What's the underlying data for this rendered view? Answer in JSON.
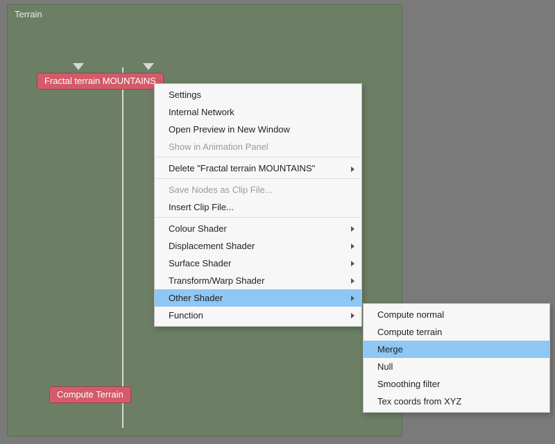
{
  "panel": {
    "title": "Terrain"
  },
  "nodes": {
    "mountains": "Fractal terrain MOUNTAINS",
    "compute": "Compute Terrain"
  },
  "menu": {
    "items": [
      {
        "label": "Settings"
      },
      {
        "label": "Internal Network"
      },
      {
        "label": "Open Preview in New Window"
      },
      {
        "label": "Show in Animation Panel",
        "disabled": true
      },
      {
        "label": "Delete \"Fractal terrain MOUNTAINS\"",
        "submenu": true
      },
      {
        "label": "Save Nodes as Clip File...",
        "disabled": true
      },
      {
        "label": "Insert Clip File..."
      },
      {
        "label": "Colour Shader",
        "submenu": true
      },
      {
        "label": "Displacement Shader",
        "submenu": true
      },
      {
        "label": "Surface Shader",
        "submenu": true
      },
      {
        "label": "Transform/Warp Shader",
        "submenu": true
      },
      {
        "label": "Other Shader",
        "submenu": true,
        "highlight": true
      },
      {
        "label": "Function",
        "submenu": true
      }
    ]
  },
  "submenu": {
    "items": [
      {
        "label": "Compute normal"
      },
      {
        "label": "Compute terrain"
      },
      {
        "label": "Merge",
        "highlight": true
      },
      {
        "label": "Null"
      },
      {
        "label": "Smoothing filter"
      },
      {
        "label": "Tex coords from XYZ"
      }
    ]
  }
}
